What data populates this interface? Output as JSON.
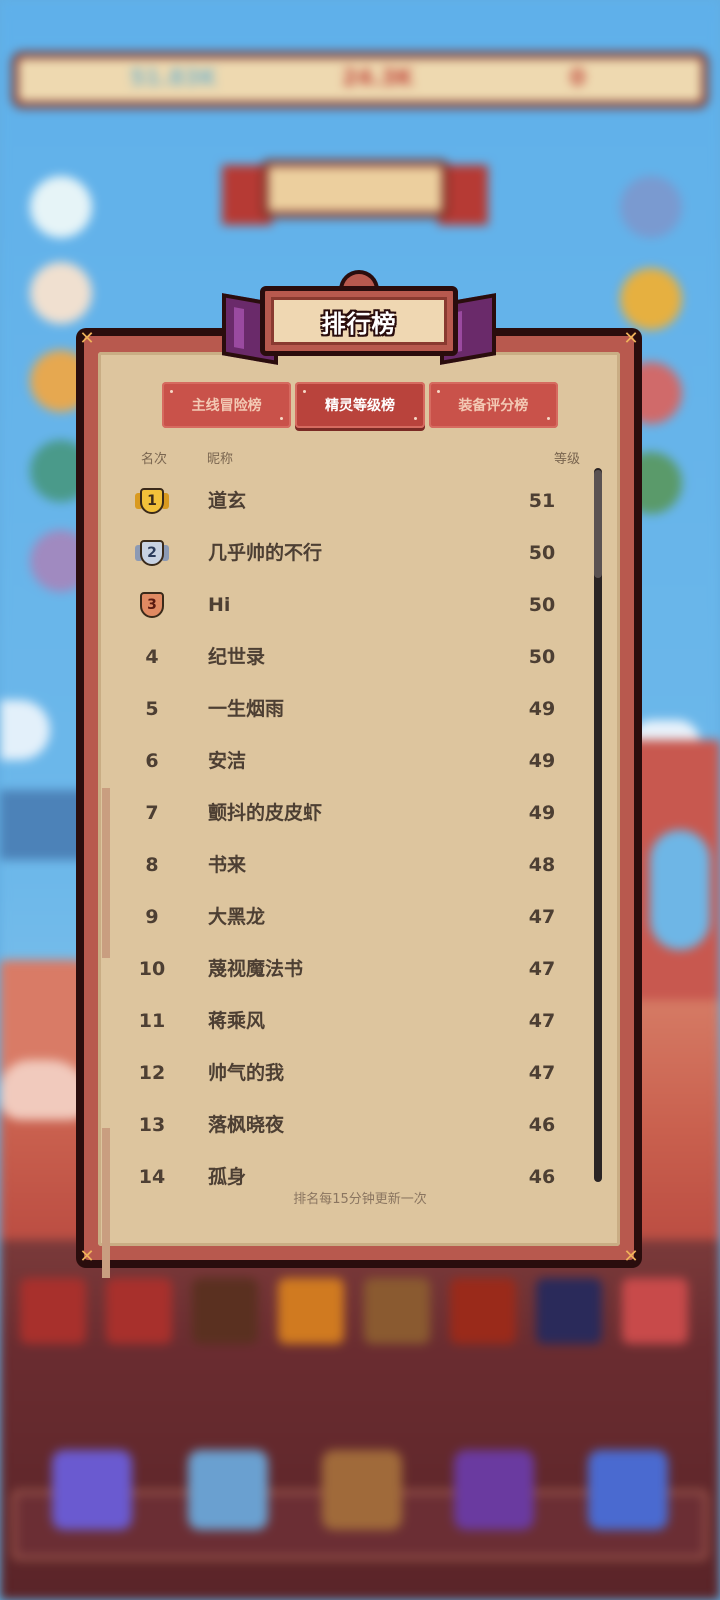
{
  "panel": {
    "title": "排行榜",
    "tabs": [
      {
        "label": "主线冒险榜",
        "active": false
      },
      {
        "label": "精灵等级榜",
        "active": true
      },
      {
        "label": "装备评分榜",
        "active": false
      }
    ],
    "headers": {
      "rank": "名次",
      "name": "昵称",
      "level": "等级"
    },
    "rows": [
      {
        "rank": "1",
        "name": "道玄",
        "level": "51",
        "medal": "gold"
      },
      {
        "rank": "2",
        "name": "几乎帅的不行",
        "level": "50",
        "medal": "silver"
      },
      {
        "rank": "3",
        "name": "Hi",
        "level": "50",
        "medal": "bronze"
      },
      {
        "rank": "4",
        "name": "纪世录",
        "level": "50"
      },
      {
        "rank": "5",
        "name": "一生烟雨",
        "level": "49"
      },
      {
        "rank": "6",
        "name": "安洁",
        "level": "49"
      },
      {
        "rank": "7",
        "name": "颤抖的皮皮虾",
        "level": "49"
      },
      {
        "rank": "8",
        "name": "书来",
        "level": "48"
      },
      {
        "rank": "9",
        "name": "大黑龙",
        "level": "47"
      },
      {
        "rank": "10",
        "name": "蔑视魔法书",
        "level": "47"
      },
      {
        "rank": "11",
        "name": "蒋乘风",
        "level": "47"
      },
      {
        "rank": "12",
        "name": "帅气的我",
        "level": "47"
      },
      {
        "rank": "13",
        "name": "落枫晓夜",
        "level": "46"
      },
      {
        "rank": "14",
        "name": "孤身",
        "level": "46"
      }
    ],
    "footer_note": "排名每15分钟更新一次",
    "scroll_position": 0.0
  },
  "background_hud": {
    "currency_1": "51.83K",
    "currency_2": "24.3K",
    "currency_3": "0",
    "colors": {
      "currency_1": "#7fb6c8",
      "currency_2": "#c0483c",
      "currency_3": "#c0483c"
    }
  },
  "colors": {
    "panel_border": "#2a0d0d",
    "panel_frame": "#b8594e",
    "panel_parchment": "#ddc59e",
    "tab_bg": "#c9524a",
    "tab_active_bg": "#b9433c",
    "text_main": "#4d3f33"
  }
}
